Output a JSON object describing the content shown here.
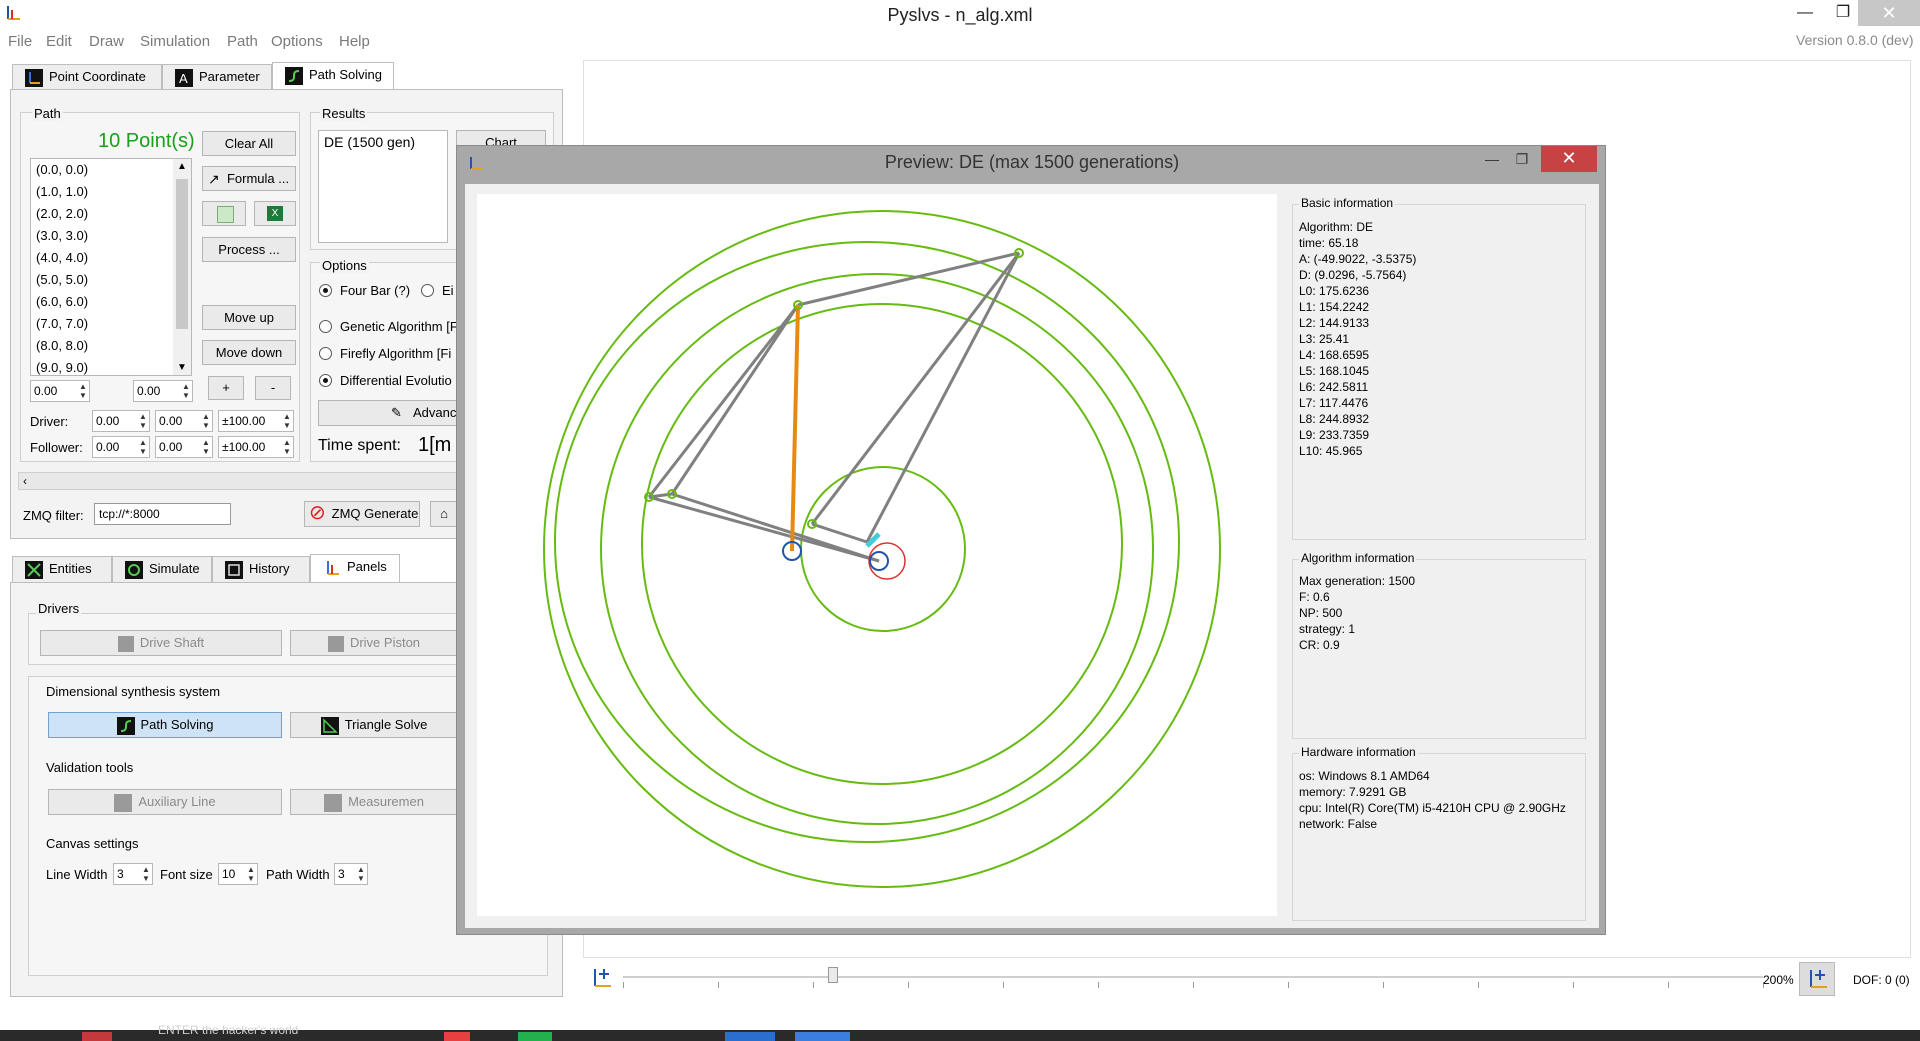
{
  "window": {
    "title": "Pyslvs - n_alg.xml",
    "version": "Version 0.8.0 (dev)"
  },
  "menu": [
    "File",
    "Edit",
    "Draw",
    "Simulation",
    "Path",
    "Options",
    "Help"
  ],
  "top_tabs": [
    "Point Coordinate",
    "Parameter",
    "Path Solving"
  ],
  "path": {
    "group_title": "Path",
    "count_label": "10 Point(s)",
    "points": [
      "(0.0, 0.0)",
      "(1.0, 1.0)",
      "(2.0, 2.0)",
      "(3.0, 3.0)",
      "(4.0, 4.0)",
      "(5.0, 5.0)",
      "(6.0, 6.0)",
      "(7.0, 7.0)",
      "(8.0, 8.0)",
      "(9.0, 9.0)"
    ],
    "clear_all": "Clear All",
    "formula": "Formula ...",
    "process": "Process ...",
    "move_up": "Move up",
    "move_down": "Move down",
    "plus": "+",
    "minus": "-",
    "x_value": "0.00",
    "y_value": "0.00",
    "driver_label": "Driver:",
    "follower_label": "Follower:",
    "driver_values": [
      "0.00",
      "0.00",
      "±100.00"
    ],
    "follower_values": [
      "0.00",
      "0.00",
      "±100.00"
    ]
  },
  "results": {
    "group_title": "Results",
    "items": [
      "DE (1500 gen)"
    ],
    "chart_button": "Chart"
  },
  "options": {
    "group_title": "Options",
    "four_bar": "Four Bar (?)",
    "eight_bar": "Ei",
    "genetic": "Genetic Algorithm [F",
    "firefly": "Firefly Algorithm [Fi",
    "differential": "Differential Evolutio",
    "advance": "Advanc",
    "time_spent_label": "Time spent:",
    "time_spent_value": "1[m"
  },
  "zmq": {
    "label": "ZMQ filter:",
    "value": "tcp://*:8000",
    "generate": "ZMQ Generate"
  },
  "bottom_tabs": [
    "Entities",
    "Simulate",
    "History",
    "Panels"
  ],
  "panels": {
    "drivers_title": "Drivers",
    "drive_shaft": "Drive Shaft",
    "drive_piston": "Drive Piston",
    "dim_title": "Dimensional synthesis system",
    "path_solving": "Path Solving",
    "triangle_solver": "Triangle Solve",
    "validation_title": "Validation tools",
    "aux_line": "Auxiliary Line",
    "measurement": "Measuremen",
    "canvas_title": "Canvas settings",
    "line_width_label": "Line Width",
    "line_width": "3",
    "font_size_label": "Font size",
    "font_size": "10",
    "path_width_label": "Path Width",
    "path_width": "3"
  },
  "preview": {
    "title": "Preview: DE (max 1500 generations)",
    "basic_title": "Basic information",
    "basic": [
      "Algorithm: DE",
      "time: 65.18",
      "A: (-49.9022, -3.5375)",
      "D: (9.0296, -5.7564)",
      "L0: 175.6236",
      "L1: 154.2242",
      "L2: 144.9133",
      "L3: 25.41",
      "L4: 168.6595",
      "L5: 168.1045",
      "L6: 242.5811",
      "L7: 117.4476",
      "L8: 244.8932",
      "L9: 233.7359",
      "L10: 45.965"
    ],
    "algo_title": "Algorithm information",
    "algo": [
      "Max generation: 1500",
      "F: 0.6",
      "NP: 500",
      "strategy: 1",
      "CR: 0.9"
    ],
    "hw_title": "Hardware information",
    "hw": [
      "os: Windows 8.1 AMD64",
      "memory: 7.9291 GB",
      "cpu: Intel(R) Core(TM) i5-4210H CPU @ 2.90GHz",
      "network: False"
    ],
    "colors": {
      "circles": "#66bb11",
      "links": "#808080",
      "driver": "#e88a10",
      "ground": "#2255aa",
      "marker": "#e03030",
      "short_link": "#44ccdd"
    }
  },
  "status": {
    "zoom": "200%",
    "dof": "DOF: 0 (0)",
    "slider_percent": 18
  },
  "taskbar": {
    "text": "ENTER the hacker's world"
  }
}
